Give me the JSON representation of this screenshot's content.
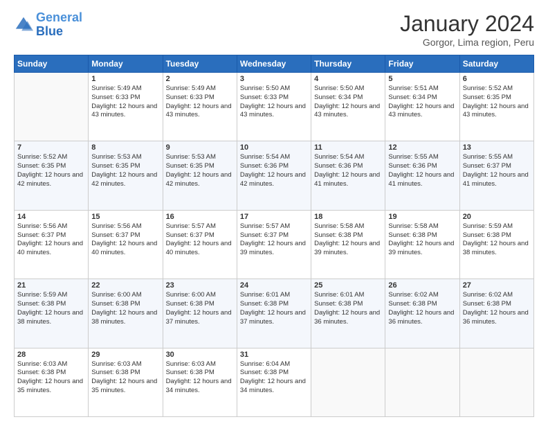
{
  "header": {
    "logo_general": "General",
    "logo_blue": "Blue",
    "month_title": "January 2024",
    "location": "Gorgor, Lima region, Peru"
  },
  "weekdays": [
    "Sunday",
    "Monday",
    "Tuesday",
    "Wednesday",
    "Thursday",
    "Friday",
    "Saturday"
  ],
  "rows": [
    {
      "shade": "white",
      "cells": [
        {
          "day": "",
          "sunrise": "",
          "sunset": "",
          "daylight": ""
        },
        {
          "day": "1",
          "sunrise": "Sunrise: 5:49 AM",
          "sunset": "Sunset: 6:33 PM",
          "daylight": "Daylight: 12 hours and 43 minutes."
        },
        {
          "day": "2",
          "sunrise": "Sunrise: 5:49 AM",
          "sunset": "Sunset: 6:33 PM",
          "daylight": "Daylight: 12 hours and 43 minutes."
        },
        {
          "day": "3",
          "sunrise": "Sunrise: 5:50 AM",
          "sunset": "Sunset: 6:33 PM",
          "daylight": "Daylight: 12 hours and 43 minutes."
        },
        {
          "day": "4",
          "sunrise": "Sunrise: 5:50 AM",
          "sunset": "Sunset: 6:34 PM",
          "daylight": "Daylight: 12 hours and 43 minutes."
        },
        {
          "day": "5",
          "sunrise": "Sunrise: 5:51 AM",
          "sunset": "Sunset: 6:34 PM",
          "daylight": "Daylight: 12 hours and 43 minutes."
        },
        {
          "day": "6",
          "sunrise": "Sunrise: 5:52 AM",
          "sunset": "Sunset: 6:35 PM",
          "daylight": "Daylight: 12 hours and 43 minutes."
        }
      ]
    },
    {
      "shade": "shade",
      "cells": [
        {
          "day": "7",
          "sunrise": "Sunrise: 5:52 AM",
          "sunset": "Sunset: 6:35 PM",
          "daylight": "Daylight: 12 hours and 42 minutes."
        },
        {
          "day": "8",
          "sunrise": "Sunrise: 5:53 AM",
          "sunset": "Sunset: 6:35 PM",
          "daylight": "Daylight: 12 hours and 42 minutes."
        },
        {
          "day": "9",
          "sunrise": "Sunrise: 5:53 AM",
          "sunset": "Sunset: 6:35 PM",
          "daylight": "Daylight: 12 hours and 42 minutes."
        },
        {
          "day": "10",
          "sunrise": "Sunrise: 5:54 AM",
          "sunset": "Sunset: 6:36 PM",
          "daylight": "Daylight: 12 hours and 42 minutes."
        },
        {
          "day": "11",
          "sunrise": "Sunrise: 5:54 AM",
          "sunset": "Sunset: 6:36 PM",
          "daylight": "Daylight: 12 hours and 41 minutes."
        },
        {
          "day": "12",
          "sunrise": "Sunrise: 5:55 AM",
          "sunset": "Sunset: 6:36 PM",
          "daylight": "Daylight: 12 hours and 41 minutes."
        },
        {
          "day": "13",
          "sunrise": "Sunrise: 5:55 AM",
          "sunset": "Sunset: 6:37 PM",
          "daylight": "Daylight: 12 hours and 41 minutes."
        }
      ]
    },
    {
      "shade": "white",
      "cells": [
        {
          "day": "14",
          "sunrise": "Sunrise: 5:56 AM",
          "sunset": "Sunset: 6:37 PM",
          "daylight": "Daylight: 12 hours and 40 minutes."
        },
        {
          "day": "15",
          "sunrise": "Sunrise: 5:56 AM",
          "sunset": "Sunset: 6:37 PM",
          "daylight": "Daylight: 12 hours and 40 minutes."
        },
        {
          "day": "16",
          "sunrise": "Sunrise: 5:57 AM",
          "sunset": "Sunset: 6:37 PM",
          "daylight": "Daylight: 12 hours and 40 minutes."
        },
        {
          "day": "17",
          "sunrise": "Sunrise: 5:57 AM",
          "sunset": "Sunset: 6:37 PM",
          "daylight": "Daylight: 12 hours and 39 minutes."
        },
        {
          "day": "18",
          "sunrise": "Sunrise: 5:58 AM",
          "sunset": "Sunset: 6:38 PM",
          "daylight": "Daylight: 12 hours and 39 minutes."
        },
        {
          "day": "19",
          "sunrise": "Sunrise: 5:58 AM",
          "sunset": "Sunset: 6:38 PM",
          "daylight": "Daylight: 12 hours and 39 minutes."
        },
        {
          "day": "20",
          "sunrise": "Sunrise: 5:59 AM",
          "sunset": "Sunset: 6:38 PM",
          "daylight": "Daylight: 12 hours and 38 minutes."
        }
      ]
    },
    {
      "shade": "shade",
      "cells": [
        {
          "day": "21",
          "sunrise": "Sunrise: 5:59 AM",
          "sunset": "Sunset: 6:38 PM",
          "daylight": "Daylight: 12 hours and 38 minutes."
        },
        {
          "day": "22",
          "sunrise": "Sunrise: 6:00 AM",
          "sunset": "Sunset: 6:38 PM",
          "daylight": "Daylight: 12 hours and 38 minutes."
        },
        {
          "day": "23",
          "sunrise": "Sunrise: 6:00 AM",
          "sunset": "Sunset: 6:38 PM",
          "daylight": "Daylight: 12 hours and 37 minutes."
        },
        {
          "day": "24",
          "sunrise": "Sunrise: 6:01 AM",
          "sunset": "Sunset: 6:38 PM",
          "daylight": "Daylight: 12 hours and 37 minutes."
        },
        {
          "day": "25",
          "sunrise": "Sunrise: 6:01 AM",
          "sunset": "Sunset: 6:38 PM",
          "daylight": "Daylight: 12 hours and 36 minutes."
        },
        {
          "day": "26",
          "sunrise": "Sunrise: 6:02 AM",
          "sunset": "Sunset: 6:38 PM",
          "daylight": "Daylight: 12 hours and 36 minutes."
        },
        {
          "day": "27",
          "sunrise": "Sunrise: 6:02 AM",
          "sunset": "Sunset: 6:38 PM",
          "daylight": "Daylight: 12 hours and 36 minutes."
        }
      ]
    },
    {
      "shade": "white",
      "cells": [
        {
          "day": "28",
          "sunrise": "Sunrise: 6:03 AM",
          "sunset": "Sunset: 6:38 PM",
          "daylight": "Daylight: 12 hours and 35 minutes."
        },
        {
          "day": "29",
          "sunrise": "Sunrise: 6:03 AM",
          "sunset": "Sunset: 6:38 PM",
          "daylight": "Daylight: 12 hours and 35 minutes."
        },
        {
          "day": "30",
          "sunrise": "Sunrise: 6:03 AM",
          "sunset": "Sunset: 6:38 PM",
          "daylight": "Daylight: 12 hours and 34 minutes."
        },
        {
          "day": "31",
          "sunrise": "Sunrise: 6:04 AM",
          "sunset": "Sunset: 6:38 PM",
          "daylight": "Daylight: 12 hours and 34 minutes."
        },
        {
          "day": "",
          "sunrise": "",
          "sunset": "",
          "daylight": ""
        },
        {
          "day": "",
          "sunrise": "",
          "sunset": "",
          "daylight": ""
        },
        {
          "day": "",
          "sunrise": "",
          "sunset": "",
          "daylight": ""
        }
      ]
    }
  ]
}
